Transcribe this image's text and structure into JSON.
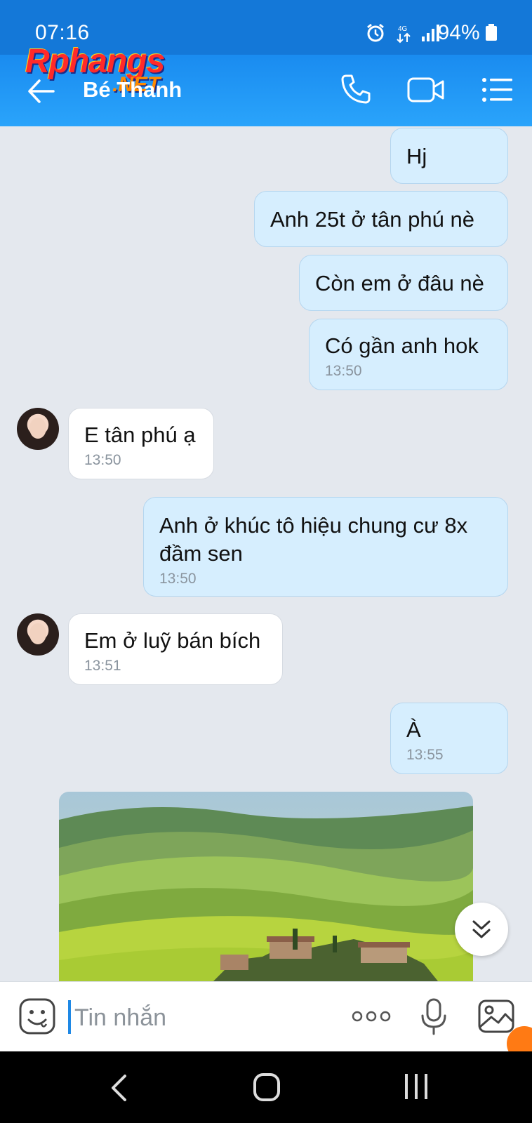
{
  "status_bar": {
    "time": "07:16",
    "battery": "94%"
  },
  "watermark": {
    "brand": "Rphangs",
    "suffix": ".NET"
  },
  "header": {
    "contact_name": "Bé Thanh"
  },
  "messages": [
    {
      "dir": "out",
      "text": "Hj",
      "time": ""
    },
    {
      "dir": "out",
      "text": "Anh 25t ở tân phú nè",
      "time": ""
    },
    {
      "dir": "out",
      "text": "Còn em ở đâu nè",
      "time": ""
    },
    {
      "dir": "out",
      "text": "Có gần anh hok",
      "time": "13:50"
    },
    {
      "dir": "in",
      "text": "E tân phú ạ",
      "time": "13:50"
    },
    {
      "dir": "out",
      "text": "Anh ở khúc tô hiệu chung cư 8x đầm sen",
      "time": "13:50"
    },
    {
      "dir": "in",
      "text": "Em ở luỹ bán bích",
      "time": "13:51"
    },
    {
      "dir": "out",
      "text": "À",
      "time": "13:55"
    }
  ],
  "composer": {
    "placeholder": "Tin nhắn"
  },
  "colors": {
    "header": "#1a8cf0",
    "outgoing_bubble": "#d6eefe",
    "incoming_bubble": "#ffffff",
    "accent": "#1e88e5"
  },
  "icons": [
    "back-arrow-icon",
    "phone-icon",
    "video-call-icon",
    "menu-list-icon",
    "emoji-icon",
    "more-dots-icon",
    "microphone-icon",
    "image-gallery-icon",
    "chevron-double-down-icon",
    "nav-back-icon",
    "nav-home-icon",
    "nav-recents-icon"
  ]
}
